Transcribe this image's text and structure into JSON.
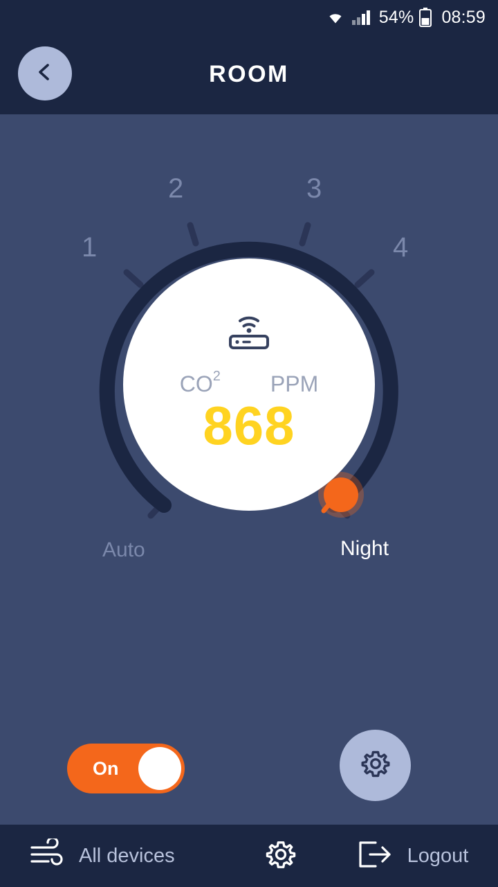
{
  "statusbar": {
    "wifi_icon": "wifi-icon",
    "signal_icon": "cellular-signal-icon",
    "battery_percent": "54%",
    "battery_icon": "battery-icon",
    "time": "08:59"
  },
  "header": {
    "back_icon": "chevron-left-icon",
    "title": "ROOM"
  },
  "dial": {
    "tick_labels": [
      "1",
      "2",
      "3",
      "4"
    ],
    "mode_left": "Auto",
    "mode_right": "Night",
    "device_icon": "router-icon",
    "metric_label": "CO",
    "metric_superscript": "2",
    "unit_label": "PPM",
    "value": "868",
    "value_color": "#ffd321",
    "knob_color": "#f4671b",
    "track_color": "#2b3556",
    "progress_color": "#1b2642"
  },
  "controls": {
    "power_toggle_label": "On",
    "power_toggle_state": "on",
    "power_toggle_color": "#f4671b",
    "settings_icon": "gear-icon"
  },
  "bottomnav": {
    "items": [
      {
        "label": "All devices",
        "icon": "fan-icon"
      },
      {
        "label": "",
        "icon": "gear-icon"
      },
      {
        "label": "Logout",
        "icon": "logout-icon"
      }
    ]
  },
  "colors": {
    "background": "#3c4a6e",
    "chrome": "#1b2642",
    "accent_orange": "#f4671b",
    "accent_yellow": "#ffd321",
    "muted_text": "#7b88ab",
    "light_button": "#aebada"
  }
}
